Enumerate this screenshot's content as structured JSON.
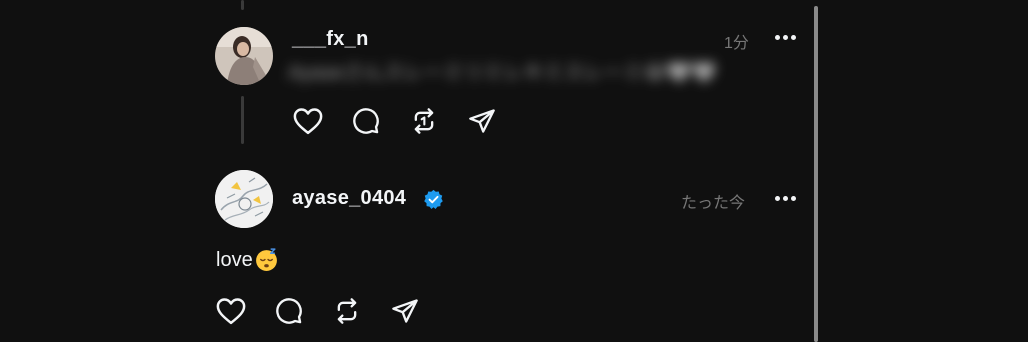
{
  "feed": {
    "reply": {
      "username": "___fx_n",
      "timestamp": "1分",
      "text": "Ayaseさんスレーミリミレキミスレーミ😂🤍🤍",
      "avatar_icon": "profile-photo"
    },
    "post": {
      "username": "ayase_0404",
      "verified": true,
      "timestamp": "たった今",
      "text": "love",
      "emoji": "sleeping-face-emoji",
      "avatar_icon": "illustration-avatar"
    },
    "action_icons": [
      "heart-icon",
      "comment-icon",
      "repost-icon",
      "share-icon"
    ]
  },
  "colors": {
    "background": "#101010",
    "text": "#f3f5f7",
    "muted": "#777777",
    "verified": "#1d9bf0"
  }
}
